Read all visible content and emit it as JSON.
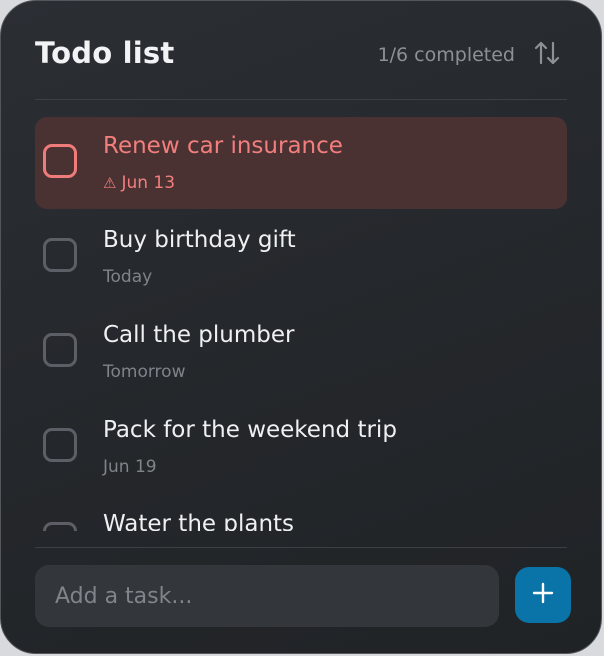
{
  "header": {
    "title": "Todo list",
    "progress": "1/6 completed",
    "sort_icon": "sort-arrows-icon"
  },
  "tasks": [
    {
      "title": "Renew car insurance",
      "due": "Jun 13",
      "status": "overdue",
      "status_icon": "warning-icon"
    },
    {
      "title": "Buy birthday gift",
      "due": "Today",
      "status": "pending"
    },
    {
      "title": "Call the plumber",
      "due": "Tomorrow",
      "status": "pending"
    },
    {
      "title": "Pack for the weekend trip",
      "due": "Jun 19",
      "status": "pending"
    },
    {
      "title": "Water the plants",
      "due": "",
      "status": "pending"
    }
  ],
  "composer": {
    "placeholder": "Add a task...",
    "add_icon": "plus-icon"
  },
  "colors": {
    "accent": "#0a73a8",
    "overdue": "#f27e7e",
    "overdue_bg": "#4a3232",
    "background": "#25282c"
  }
}
